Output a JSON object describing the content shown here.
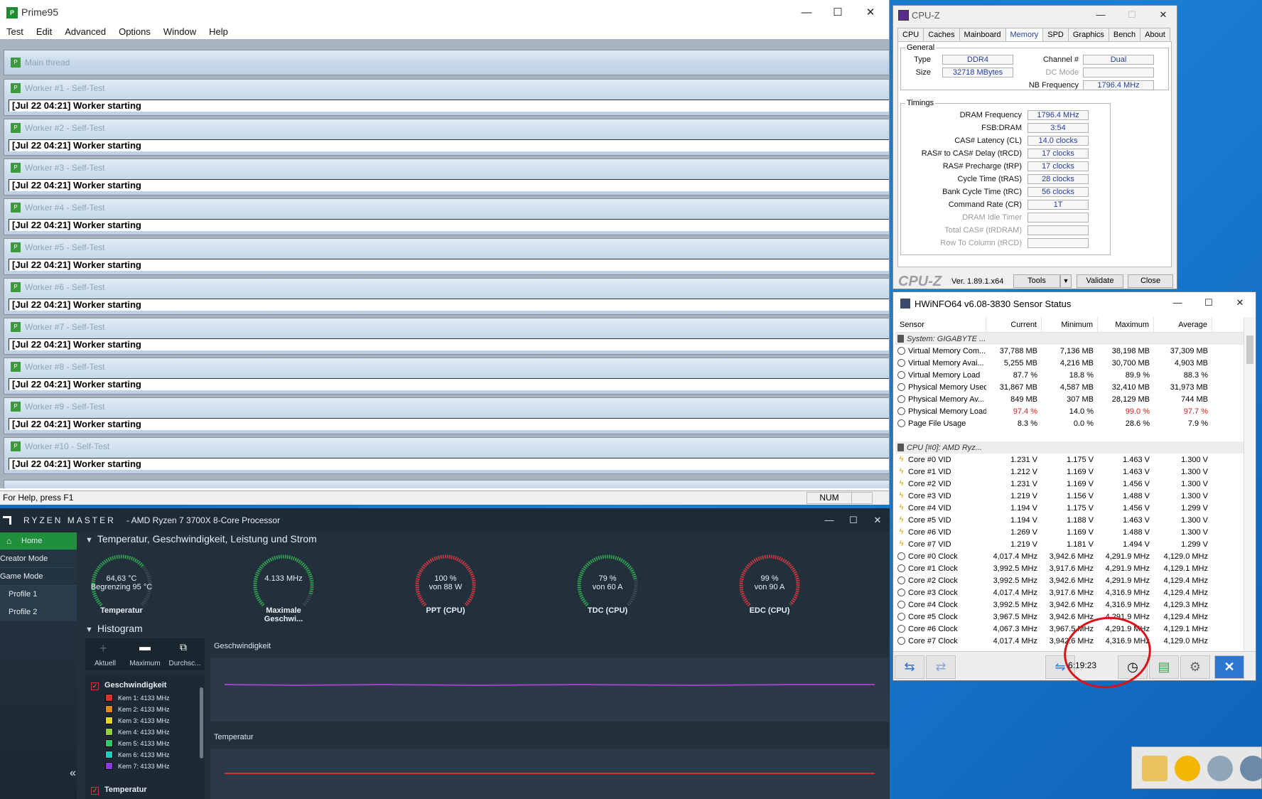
{
  "prime95": {
    "title": "Prime95",
    "menu": [
      "Test",
      "Edit",
      "Advanced",
      "Options",
      "Window",
      "Help"
    ],
    "main_thread": "Main thread",
    "workers": [
      {
        "title": "Worker #1 - Self-Test",
        "line": "[Jul 22 04:21] Worker starting"
      },
      {
        "title": "Worker #2 - Self-Test",
        "line": "[Jul 22 04:21] Worker starting"
      },
      {
        "title": "Worker #3 - Self-Test",
        "line": "[Jul 22 04:21] Worker starting"
      },
      {
        "title": "Worker #4 - Self-Test",
        "line": "[Jul 22 04:21] Worker starting"
      },
      {
        "title": "Worker #5 - Self-Test",
        "line": "[Jul 22 04:21] Worker starting"
      },
      {
        "title": "Worker #6 - Self-Test",
        "line": "[Jul 22 04:21] Worker starting"
      },
      {
        "title": "Worker #7 - Self-Test",
        "line": "[Jul 22 04:21] Worker starting"
      },
      {
        "title": "Worker #8 - Self-Test",
        "line": "[Jul 22 04:21] Worker starting"
      },
      {
        "title": "Worker #9 - Self-Test",
        "line": "[Jul 22 04:21] Worker starting"
      },
      {
        "title": "Worker #10 - Self-Test",
        "line": "[Jul 22 04:21] Worker starting"
      }
    ],
    "status_text": "For Help, press F1",
    "num": "NUM"
  },
  "cpuz": {
    "title": "CPU-Z",
    "tabs": [
      "CPU",
      "Caches",
      "Mainboard",
      "Memory",
      "SPD",
      "Graphics",
      "Bench",
      "About"
    ],
    "active_tab": "Memory",
    "general_legend": "General",
    "type_label": "Type",
    "type_value": "DDR4",
    "size_label": "Size",
    "size_value": "32718 MBytes",
    "channel_label": "Channel #",
    "channel_value": "Dual",
    "dcmode_label": "DC Mode",
    "dcmode_value": "",
    "nbfreq_label": "NB Frequency",
    "nbfreq_value": "1796.4 MHz",
    "timings_legend": "Timings",
    "timings": [
      {
        "label": "DRAM Frequency",
        "value": "1796.4 MHz",
        "dim": false
      },
      {
        "label": "FSB:DRAM",
        "value": "3:54",
        "dim": false
      },
      {
        "label": "CAS# Latency (CL)",
        "value": "14.0 clocks",
        "dim": false
      },
      {
        "label": "RAS# to CAS# Delay (tRCD)",
        "value": "17 clocks",
        "dim": false
      },
      {
        "label": "RAS# Precharge (tRP)",
        "value": "17 clocks",
        "dim": false
      },
      {
        "label": "Cycle Time (tRAS)",
        "value": "28 clocks",
        "dim": false
      },
      {
        "label": "Bank Cycle Time (tRC)",
        "value": "56 clocks",
        "dim": false
      },
      {
        "label": "Command Rate (CR)",
        "value": "1T",
        "dim": false
      },
      {
        "label": "DRAM Idle Timer",
        "value": "",
        "dim": true
      },
      {
        "label": "Total CAS# (tRDRAM)",
        "value": "",
        "dim": true
      },
      {
        "label": "Row To Column (tRCD)",
        "value": "",
        "dim": true
      }
    ],
    "logo": "CPU-Z",
    "version": "Ver. 1.89.1.x64",
    "tools": "Tools",
    "validate": "Validate",
    "close": "Close"
  },
  "hwinfo": {
    "title": "HWiNFO64 v6.08-3830 Sensor Status",
    "columns": [
      "Sensor",
      "Current",
      "Minimum",
      "Maximum",
      "Average"
    ],
    "rows": [
      {
        "t": "g",
        "n": "System: GIGABYTE ...",
        "c": "",
        "mi": "",
        "ma": "",
        "av": ""
      },
      {
        "t": "o",
        "n": "Virtual Memory Com...",
        "c": "37,788 MB",
        "mi": "7,136 MB",
        "ma": "38,198 MB",
        "av": "37,309 MB"
      },
      {
        "t": "o",
        "n": "Virtual Memory Avai...",
        "c": "5,255 MB",
        "mi": "4,216 MB",
        "ma": "30,700 MB",
        "av": "4,903 MB"
      },
      {
        "t": "o",
        "n": "Virtual Memory Load",
        "c": "87.7 %",
        "mi": "18.8 %",
        "ma": "89.9 %",
        "av": "88.3 %"
      },
      {
        "t": "o",
        "n": "Physical Memory Used",
        "c": "31,867 MB",
        "mi": "4,587 MB",
        "ma": "32,410 MB",
        "av": "31,973 MB"
      },
      {
        "t": "o",
        "n": "Physical Memory Av...",
        "c": "849 MB",
        "mi": "307 MB",
        "ma": "28,129 MB",
        "av": "744 MB"
      },
      {
        "t": "o",
        "n": "Physical Memory Load",
        "c": "97.4 %",
        "mi": "14.0 %",
        "ma": "99.0 %",
        "av": "97.7 %",
        "red": true
      },
      {
        "t": "o",
        "n": "Page File Usage",
        "c": "8.3 %",
        "mi": "0.0 %",
        "ma": "28.6 %",
        "av": "7.9 %"
      },
      {
        "t": "b",
        "n": "",
        "c": "",
        "mi": "",
        "ma": "",
        "av": ""
      },
      {
        "t": "g",
        "n": "CPU [#0]: AMD Ryz...",
        "c": "",
        "mi": "",
        "ma": "",
        "av": ""
      },
      {
        "t": "v",
        "n": "Core #0 VID",
        "c": "1.231 V",
        "mi": "1.175 V",
        "ma": "1.463 V",
        "av": "1.300 V"
      },
      {
        "t": "v",
        "n": "Core #1 VID",
        "c": "1.212 V",
        "mi": "1.169 V",
        "ma": "1.463 V",
        "av": "1.300 V"
      },
      {
        "t": "v",
        "n": "Core #2 VID",
        "c": "1.231 V",
        "mi": "1.169 V",
        "ma": "1.456 V",
        "av": "1.300 V"
      },
      {
        "t": "v",
        "n": "Core #3 VID",
        "c": "1.219 V",
        "mi": "1.156 V",
        "ma": "1.488 V",
        "av": "1.300 V"
      },
      {
        "t": "v",
        "n": "Core #4 VID",
        "c": "1.194 V",
        "mi": "1.175 V",
        "ma": "1.456 V",
        "av": "1.299 V"
      },
      {
        "t": "v",
        "n": "Core #5 VID",
        "c": "1.194 V",
        "mi": "1.188 V",
        "ma": "1.463 V",
        "av": "1.300 V"
      },
      {
        "t": "v",
        "n": "Core #6 VID",
        "c": "1.269 V",
        "mi": "1.169 V",
        "ma": "1.488 V",
        "av": "1.300 V"
      },
      {
        "t": "v",
        "n": "Core #7 VID",
        "c": "1.219 V",
        "mi": "1.181 V",
        "ma": "1.494 V",
        "av": "1.299 V"
      },
      {
        "t": "o",
        "n": "Core #0 Clock",
        "c": "4,017.4 MHz",
        "mi": "3,942.6 MHz",
        "ma": "4,291.9 MHz",
        "av": "4,129.0 MHz"
      },
      {
        "t": "o",
        "n": "Core #1 Clock",
        "c": "3,992.5 MHz",
        "mi": "3,917.6 MHz",
        "ma": "4,291.9 MHz",
        "av": "4,129.1 MHz"
      },
      {
        "t": "o",
        "n": "Core #2 Clock",
        "c": "3,992.5 MHz",
        "mi": "3,942.6 MHz",
        "ma": "4,291.9 MHz",
        "av": "4,129.4 MHz"
      },
      {
        "t": "o",
        "n": "Core #3 Clock",
        "c": "4,017.4 MHz",
        "mi": "3,917.6 MHz",
        "ma": "4,316.9 MHz",
        "av": "4,129.4 MHz"
      },
      {
        "t": "o",
        "n": "Core #4 Clock",
        "c": "3,992.5 MHz",
        "mi": "3,942.6 MHz",
        "ma": "4,316.9 MHz",
        "av": "4,129.3 MHz"
      },
      {
        "t": "o",
        "n": "Core #5 Clock",
        "c": "3,967.5 MHz",
        "mi": "3,942.6 MHz",
        "ma": "4,291.9 MHz",
        "av": "4,129.4 MHz"
      },
      {
        "t": "o",
        "n": "Core #6 Clock",
        "c": "4,067.3 MHz",
        "mi": "3,967.5 MHz",
        "ma": "4,291.9 MHz",
        "av": "4,129.1 MHz"
      },
      {
        "t": "o",
        "n": "Core #7 Clock",
        "c": "4,017.4 MHz",
        "mi": "3,942.6 MHz",
        "ma": "4,316.9 MHz",
        "av": "4,129.0 MHz"
      }
    ],
    "time": "6:19:23"
  },
  "ryzen": {
    "title": "RYZEN MASTER",
    "subtitle": "-  AMD Ryzen 7 3700X 8-Core Processor",
    "sidebar": [
      "Home",
      "Creator Mode",
      "Game Mode",
      "Profile 1",
      "Profile 2"
    ],
    "section1": "Temperatur, Geschwindigkeit, Leistung und Strom",
    "gauges": [
      {
        "l1": "64,63 °C",
        "l2": "Begrenzing  95 °C",
        "label": "Temperatur",
        "fill": 0.68,
        "color": "#2fa84f"
      },
      {
        "l1": "4.133  MHz",
        "l2": "",
        "label": "Maximale Geschwi...",
        "fill": 0.9,
        "color": "#2fa84f"
      },
      {
        "l1": "100 %",
        "l2": "von  88 W",
        "label": "PPT (CPU)",
        "fill": 1.0,
        "color": "#d2373d"
      },
      {
        "l1": "79 %",
        "l2": "von  60 A",
        "label": "TDC (CPU)",
        "fill": 0.79,
        "color": "#2fa84f"
      },
      {
        "l1": "99 %",
        "l2": "von  90 A",
        "label": "EDC (CPU)",
        "fill": 0.99,
        "color": "#d2373d"
      }
    ],
    "section2": "Histogram",
    "hist_tabs": [
      "Aktuell",
      "Maximum",
      "Durchsc..."
    ],
    "legend_group1": "Geschwindigkeit",
    "legend_items": [
      {
        "label": "Kern 1: 4133 MHz",
        "color": "#d9342b"
      },
      {
        "label": "Kern 2: 4133 MHz",
        "color": "#e08a1e"
      },
      {
        "label": "Kern 3: 4133 MHz",
        "color": "#e3d42a"
      },
      {
        "label": "Kern 4: 4133 MHz",
        "color": "#8fd03c"
      },
      {
        "label": "Kern 5: 4133 MHz",
        "color": "#2fc86a"
      },
      {
        "label": "Kern 6: 4133 MHz",
        "color": "#22c9c0"
      },
      {
        "label": "Kern 7: 4133 MHz",
        "color": "#8a3ad9"
      }
    ],
    "legend_group2": "Temperatur",
    "graph1_title": "Geschwindigkeit",
    "graph2_title": "Temperatur"
  }
}
